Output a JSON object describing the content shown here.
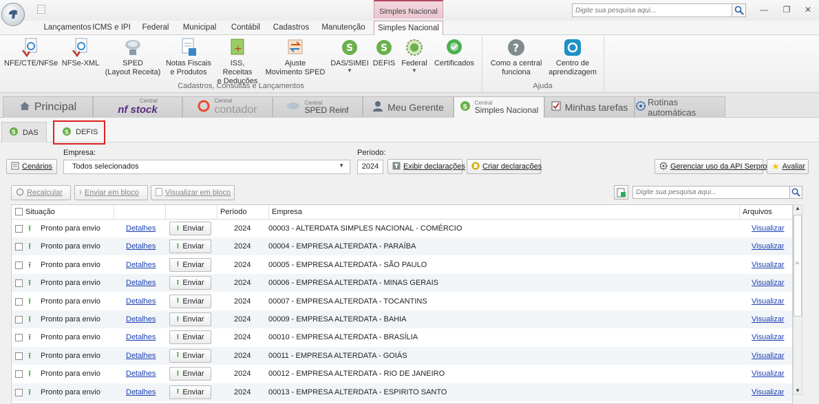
{
  "window": {
    "context_tab_title": "Simples Nacional",
    "search_placeholder": "Digite sua pesquisa aqui..."
  },
  "ribbon_tabs": [
    {
      "label": "Lançamentos"
    },
    {
      "label": "ICMS e IPI"
    },
    {
      "label": "Federal"
    },
    {
      "label": "Municipal"
    },
    {
      "label": "Contábil"
    },
    {
      "label": "Cadastros"
    },
    {
      "label": "Manutenção"
    },
    {
      "label": "Simples Nacional",
      "active": true
    }
  ],
  "ribbon": {
    "buttons": [
      {
        "label1": "NFE/CTE/NFSe",
        "label2": "",
        "icon": "nfe-icon"
      },
      {
        "label1": "NFSe-XML",
        "label2": "",
        "icon": "nfse-xml-icon"
      },
      {
        "label1": "SPED",
        "label2": "(Layout Receita)",
        "icon": "sped-icon"
      },
      {
        "label1": "Notas Fiscais",
        "label2": "e Produtos",
        "icon": "notas-fiscais-icon"
      },
      {
        "label1": "ISS, Receitas",
        "label2": "e Deduções",
        "icon": "iss-icon"
      },
      {
        "label1": "Ajuste",
        "label2": "Movimento SPED",
        "icon": "ajuste-icon"
      },
      {
        "label1": "DAS/SIMEI",
        "label2": "",
        "icon": "das-simei-icon",
        "dropdown": true
      },
      {
        "label1": "DEFIS",
        "label2": "",
        "icon": "defis-icon"
      },
      {
        "label1": "Federal",
        "label2": "",
        "icon": "federal-icon",
        "dropdown": true
      },
      {
        "label1": "Certificados",
        "label2": "",
        "icon": "certificados-icon"
      },
      {
        "label1": "Como a central",
        "label2": "funciona",
        "icon": "help-icon"
      },
      {
        "label1": "Centro de",
        "label2": "aprendizagem",
        "icon": "learning-icon"
      }
    ],
    "groups": {
      "main": "Cadastros, Consultas e Lançamentos",
      "help": "Ajuda"
    }
  },
  "module_tabs": {
    "principal": "Principal",
    "nfstock_small": "Central",
    "nfstock": "nf stock",
    "contador_small": "Central",
    "contador": "contador",
    "reinf_small": "Central",
    "reinf": "SPED Reinf",
    "gerente": "Meu Gerente",
    "simples_small": "Central",
    "simples": "Simples Nacional",
    "tarefas": "Minhas tarefas",
    "rotinas": "Rotinas automáticas"
  },
  "sub_tabs": {
    "das": "DAS",
    "defis": "DEFIS"
  },
  "filters": {
    "cenarios": "Cenários",
    "empresa_label": "Empresa:",
    "empresa_value": "Todos selecionados",
    "periodo_label": "Período:",
    "periodo_value": "2024",
    "exibir": "Exibir declarações",
    "criar": "Criar declarações",
    "gerenciar": "Gerenciar uso da API Serpro",
    "avaliar": "Avaliar"
  },
  "toolbar": {
    "recalcular": "Recalcular",
    "enviar_bloco": "Enviar em bloco",
    "visualizar_bloco": "Visualizar em bloco",
    "search_placeholder": "Digite sua pesquisa aqui..."
  },
  "grid": {
    "columns": {
      "situacao": "Situação",
      "periodo": "Período",
      "empresa": "Empresa",
      "arquivos": "Arquivos"
    },
    "detalhes_label": "Detalhes",
    "enviar_label": "Enviar",
    "visualizar_label": "Visualizar",
    "rows": [
      {
        "situacao": "Pronto para envio",
        "periodo": "2024",
        "empresa": "00003 - ALTERDATA SIMPLES NACIONAL - COMÉRCIO"
      },
      {
        "situacao": "Pronto para envio",
        "periodo": "2024",
        "empresa": "00004 - EMPRESA ALTERDATA - PARAÍBA"
      },
      {
        "situacao": "Pronto para envio",
        "periodo": "2024",
        "empresa": "00005 - EMPRESA ALTERDATA - SÃO PAULO"
      },
      {
        "situacao": "Pronto para envio",
        "periodo": "2024",
        "empresa": "00006 - EMPRESA ALTERDATA - MINAS GERAIS"
      },
      {
        "situacao": "Pronto para envio",
        "periodo": "2024",
        "empresa": "00007 - EMPRESA ALTERDATA - TOCANTINS"
      },
      {
        "situacao": "Pronto para envio",
        "periodo": "2024",
        "empresa": "00009 - EMPRESA ALTERDATA - BAHIA"
      },
      {
        "situacao": "Pronto para envio",
        "periodo": "2024",
        "empresa": "00010 - EMPRESA ALTERDATA - BRASÍLIA"
      },
      {
        "situacao": "Pronto para envio",
        "periodo": "2024",
        "empresa": "00011 - EMPRESA ALTERDATA - GOIÁS"
      },
      {
        "situacao": "Pronto para envio",
        "periodo": "2024",
        "empresa": "00012 - EMPRESA ALTERDATA - RIO DE JANEIRO"
      },
      {
        "situacao": "Pronto para envio",
        "periodo": "2024",
        "empresa": "00013 - EMPRESA ALTERDATA - ESPIRITO SANTO"
      }
    ]
  }
}
